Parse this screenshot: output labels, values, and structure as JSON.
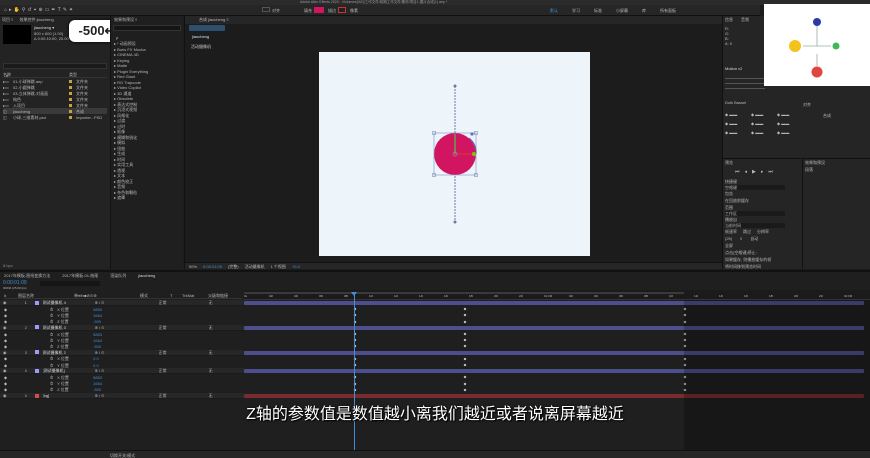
{
  "app": {
    "title": "Adobe After Effects 2020 - /Volumes/[AE]/工作文件/前期工作文件/素材/项目1-图片合成(1).aep *"
  },
  "menubar": {
    "workspace_tabs": [
      "默认",
      "学习",
      "标准",
      "小屏幕",
      "库",
      "所有面板",
      "效果",
      "运动跟踪",
      "基本图形"
    ]
  },
  "toolbar": {
    "snap_label": "对齐",
    "fill_label": "填充",
    "stroke_label": "描边",
    "stroke_px": "像素"
  },
  "project": {
    "tab_label": "项目 ≡",
    "tab2_label": "效果控件 jiaocheng",
    "comp_name": "jiaocheng ▾",
    "comp_info1": "800 x 600 (1.00)",
    "comp_info2": "Δ 0:00:10:00, 25.00 fps",
    "search_placeholder": "ρ",
    "col_name": "名称",
    "col_type": "类型",
    "items": [
      {
        "name": "01-小球弹跳.aep",
        "type": "文件夹"
      },
      {
        "name": "02-小圆弹跳",
        "type": "文件夹"
      },
      {
        "name": "03-立体弹跳-对画面",
        "type": "文件夹"
      },
      {
        "name": "纯色",
        "type": "文件夹"
      },
      {
        "name": "入项目",
        "type": "文件夹"
      },
      {
        "name": "jiaocheng",
        "type": "合成"
      },
      {
        "name": "小球-三维素材.psd",
        "type": "Importer...PSD"
      }
    ],
    "bpc": "8 bpc"
  },
  "overlay_badge": "-500↩",
  "effects": {
    "tab_label": "效果和预设 ≡",
    "search_placeholder": "ρ",
    "items": [
      "* 动画预设",
      "Boris FX Mocha",
      "CINEMA 4D",
      "Keying",
      "Matte",
      "Plugin Everything",
      "Red Giant",
      "RG Trapcode",
      "Video Copilot",
      "3D 通道",
      "Obsolete",
      "表达式控制",
      "沉浸式视频",
      "风格化",
      "过渡",
      "过时",
      "抠像",
      "模糊和锐化",
      "模拟",
      "扭曲",
      "生成",
      "时间",
      "实用工具",
      "透视",
      "文本",
      "颜色校正",
      "音频",
      "杂色和颗粒",
      "遮罩"
    ]
  },
  "comp": {
    "tab_label": "合成 jiaocheng ≡",
    "breadcrumb": "jiaocheng",
    "camera_label": "活动摄像机",
    "ruler": [],
    "footer": {
      "zoom": "50%",
      "time": "0:00:01:09",
      "quality": "(完整)",
      "camera": "活动摄像机",
      "views": "1 个视图",
      "offset": "+0.0"
    }
  },
  "right": {
    "info_tab": "信息",
    "audio_tab": "音频",
    "preview_tab": "预览",
    "effects_tab": "效果和预设",
    "align_tab": "对齐",
    "align_to": "合成",
    "tracker_label": "Motion v2",
    "tracker2": "Duik Bassel",
    "info": [
      "R: ",
      "G: ",
      "B: ",
      "A: 0",
      "X: 8000",
      "Y: 4500"
    ],
    "preview": {
      "shortcut_label": "快捷键",
      "shortcut_val": "空格键",
      "include_label": "包含",
      "cache_label": "在回放前缓存",
      "range_label": "范围",
      "range_val": "工作区",
      "play_from_label": "播放自",
      "play_from_val": "当前时间",
      "fps_label": "帧速率",
      "skip_label": "跳过",
      "res_label": "分辨率",
      "fps_val": "(25)",
      "skip_val": "0",
      "res_val": "自动",
      "fullscreen_label": "全屏",
      "stop_label": "点击(空格键)停止:",
      "cache_check": "如果缓存, 则播放缓存的帧",
      "move_time": "将时间移到预览时间"
    },
    "paragraph_tab": "段落"
  },
  "timeline": {
    "tabs": [
      "2017年模板-图纸变换方法",
      "2017年模板-01-结尾",
      "渲染队列",
      "jiaocheng"
    ],
    "timecode": "0:00:01:09",
    "frames": "00034 (25.00 fps)",
    "col_headers": [
      "#",
      "图层名称",
      "单♦\\fx■⊘⊙⊕",
      "模式",
      "T",
      "TrkMat",
      "父级和链接"
    ],
    "layers": [
      {
        "num": "1",
        "name": "测试摄像机 4",
        "color": "#9a9aff",
        "mode": "正常",
        "parent": "无",
        "subs": [
          [
            "X 位置",
            "5853"
          ],
          [
            "Y 位置",
            "1664"
          ],
          [
            "Z 位置",
            "-500"
          ]
        ]
      },
      {
        "num": "2",
        "name": "测试摄像机 3",
        "color": "#9a9aff",
        "mode": "正常",
        "parent": "无",
        "subs": [
          [
            "X 位置",
            "5853"
          ],
          [
            "Y 位置",
            "1664"
          ],
          [
            "Z 位置",
            "-500"
          ]
        ]
      },
      {
        "num": "3",
        "name": "测试摄像机 2",
        "color": "#9a9aff",
        "mode": "正常",
        "parent": "无",
        "subs": [
          [
            "X 位置",
            "0.0"
          ],
          [
            "Y 位置",
            "0.0"
          ]
        ]
      },
      {
        "num": "4",
        "name": "[测试摄像机]",
        "color": "#9a9aff",
        "mode": "正常",
        "parent": "无",
        "subs": [
          [
            "X 位置",
            "5853"
          ],
          [
            "Y 位置",
            "1664"
          ],
          [
            "Z 位置",
            "-500"
          ]
        ]
      },
      {
        "num": "5",
        "name": "[bg]",
        "color": "#d94b4b",
        "mode": "正常",
        "parent": "无",
        "subs": []
      }
    ],
    "ruler": [
      "0s",
      "02f",
      "04f",
      "06f",
      "08f",
      "10f",
      "12f",
      "14f",
      "16f",
      "18f",
      "20f",
      "22f",
      "01:00f",
      "02f",
      "04f",
      "06f",
      "08f",
      "10f",
      "12f",
      "14f",
      "16f",
      "18f",
      "20f",
      "22f",
      "02:00f"
    ],
    "footer": "切换开关/模式"
  },
  "subtitle": "Z轴的参数值是数值越小离我们越近或者说离屏幕越近",
  "colors": {
    "ball": "#d11561",
    "canvas": "#edf5fb",
    "accent": "#3f8fd9",
    "layer_bar": "#4d4f8c",
    "bg_bar": "#7a2b2f"
  }
}
